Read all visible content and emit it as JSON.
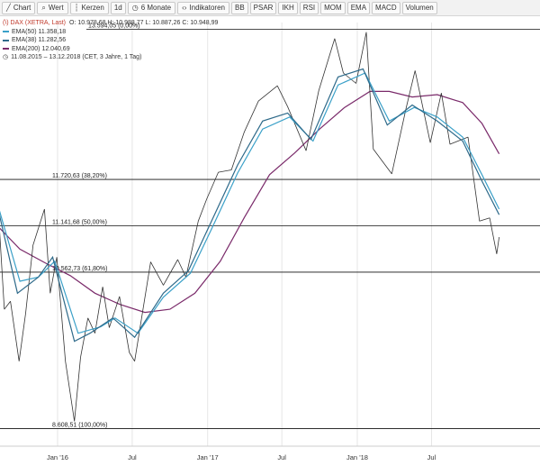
{
  "toolbar": {
    "items": [
      {
        "icon": "line-chart-icon",
        "label": "Chart"
      },
      {
        "icon": "search-icon",
        "label": "Wert"
      },
      {
        "icon": "candle-icon",
        "label": "Kerzen"
      },
      {
        "icon": "",
        "label": "1d"
      },
      {
        "icon": "clock-icon",
        "label": "6 Monate"
      },
      {
        "icon": "code-icon",
        "label": "Indikatoren"
      },
      {
        "icon": "",
        "label": "BB"
      },
      {
        "icon": "",
        "label": "PSAR"
      },
      {
        "icon": "",
        "label": "IKH"
      },
      {
        "icon": "",
        "label": "RSI"
      },
      {
        "icon": "",
        "label": "MOM"
      },
      {
        "icon": "",
        "label": "EMA"
      },
      {
        "icon": "",
        "label": "MACD"
      },
      {
        "icon": "",
        "label": "Volumen"
      }
    ]
  },
  "legend": {
    "instrument": "(\\) DAX (XETRA, Last)",
    "ohlc": "O: 10.978,68  H: 10.988,77  L: 10.887,26  C: 10.948,99",
    "ema50": "EMA(50)  11.358,18",
    "ema38": "EMA(38)  11.282,56",
    "ema200": "EMA(200)  12.040,69",
    "range": "11.08.2015 – 13.12.2018   (CET, 3 Jahre, 1 Tag)"
  },
  "colors": {
    "ema50": "#3aa0c8",
    "ema38": "#2e6a8a",
    "ema200": "#7a2a6a",
    "price": "#333333"
  },
  "chart_data": {
    "type": "line",
    "x_ticks": [
      "Jan '16",
      "Jul",
      "Jan '17",
      "Jul",
      "Jan '18",
      "Jul"
    ],
    "fib_levels": [
      {
        "label": "13.594,05 (0,00%)",
        "value": 13594.05
      },
      {
        "label": "11.720,63 (38,20%)",
        "value": 11720.63
      },
      {
        "label": "11.141,68 (50,00%)",
        "value": 11141.68
      },
      {
        "label": "10.562,73 (61,80%)",
        "value": 10562.73
      },
      {
        "label": "8.608,51 (100,00%)",
        "value": 8608.51
      }
    ],
    "ylim": [
      8480,
      13680
    ],
    "price": [
      [
        "2015-08-11",
        11200
      ],
      [
        "2015-08-24",
        10100
      ],
      [
        "2015-09-08",
        10200
      ],
      [
        "2015-09-29",
        9450
      ],
      [
        "2015-10-15",
        10050
      ],
      [
        "2015-11-02",
        10900
      ],
      [
        "2015-11-30",
        11350
      ],
      [
        "2015-12-14",
        10300
      ],
      [
        "2015-12-30",
        10750
      ],
      [
        "2016-01-20",
        9450
      ],
      [
        "2016-02-11",
        8700
      ],
      [
        "2016-02-26",
        9500
      ],
      [
        "2016-03-15",
        9990
      ],
      [
        "2016-04-01",
        9800
      ],
      [
        "2016-04-20",
        10380
      ],
      [
        "2016-05-06",
        9870
      ],
      [
        "2016-05-31",
        10260
      ],
      [
        "2016-06-24",
        9560
      ],
      [
        "2016-07-07",
        9450
      ],
      [
        "2016-08-15",
        10690
      ],
      [
        "2016-09-15",
        10400
      ],
      [
        "2016-10-20",
        10720
      ],
      [
        "2016-11-09",
        10500
      ],
      [
        "2016-12-09",
        11200
      ],
      [
        "2016-12-30",
        11480
      ],
      [
        "2017-01-27",
        11810
      ],
      [
        "2017-02-28",
        11840
      ],
      [
        "2017-03-31",
        12310
      ],
      [
        "2017-05-05",
        12700
      ],
      [
        "2017-06-20",
        12890
      ],
      [
        "2017-07-15",
        12630
      ],
      [
        "2017-08-29",
        12080
      ],
      [
        "2017-09-29",
        12830
      ],
      [
        "2017-11-07",
        13480
      ],
      [
        "2017-11-28",
        13050
      ],
      [
        "2017-12-29",
        12920
      ],
      [
        "2018-01-23",
        13560
      ],
      [
        "2018-02-09",
        12100
      ],
      [
        "2018-03-26",
        11790
      ],
      [
        "2018-04-30",
        12610
      ],
      [
        "2018-05-22",
        13080
      ],
      [
        "2018-06-28",
        12180
      ],
      [
        "2018-07-25",
        12800
      ],
      [
        "2018-08-15",
        12160
      ],
      [
        "2018-09-28",
        12250
      ],
      [
        "2018-10-26",
        11200
      ],
      [
        "2018-11-20",
        11240
      ],
      [
        "2018-12-07",
        10790
      ],
      [
        "2018-12-13",
        11000
      ]
    ],
    "ema38": [
      [
        "2015-08-11",
        11300
      ],
      [
        "2015-09-25",
        10300
      ],
      [
        "2015-11-15",
        10500
      ],
      [
        "2015-12-20",
        10750
      ],
      [
        "2016-02-11",
        9700
      ],
      [
        "2016-03-20",
        9800
      ],
      [
        "2016-05-15",
        9990
      ],
      [
        "2016-07-07",
        9750
      ],
      [
        "2016-09-15",
        10300
      ],
      [
        "2016-11-15",
        10580
      ],
      [
        "2017-01-15",
        11250
      ],
      [
        "2017-03-15",
        11900
      ],
      [
        "2017-05-15",
        12450
      ],
      [
        "2017-07-15",
        12550
      ],
      [
        "2017-09-10",
        12220
      ],
      [
        "2017-11-15",
        13000
      ],
      [
        "2018-01-15",
        13100
      ],
      [
        "2018-03-15",
        12400
      ],
      [
        "2018-05-15",
        12650
      ],
      [
        "2018-07-15",
        12450
      ],
      [
        "2018-09-15",
        12200
      ],
      [
        "2018-11-01",
        11700
      ],
      [
        "2018-12-13",
        11280
      ]
    ],
    "ema50": [
      [
        "2015-08-11",
        11350
      ],
      [
        "2015-10-01",
        10450
      ],
      [
        "2015-11-15",
        10500
      ],
      [
        "2015-12-25",
        10700
      ],
      [
        "2016-02-20",
        9800
      ],
      [
        "2016-04-15",
        9880
      ],
      [
        "2016-05-20",
        9990
      ],
      [
        "2016-07-15",
        9800
      ],
      [
        "2016-09-15",
        10250
      ],
      [
        "2016-11-20",
        10550
      ],
      [
        "2017-01-15",
        11150
      ],
      [
        "2017-03-15",
        11800
      ],
      [
        "2017-05-15",
        12350
      ],
      [
        "2017-07-20",
        12500
      ],
      [
        "2017-09-15",
        12200
      ],
      [
        "2017-11-15",
        12900
      ],
      [
        "2018-01-20",
        13050
      ],
      [
        "2018-03-20",
        12450
      ],
      [
        "2018-05-20",
        12620
      ],
      [
        "2018-07-15",
        12500
      ],
      [
        "2018-09-15",
        12250
      ],
      [
        "2018-11-01",
        11780
      ],
      [
        "2018-12-13",
        11350
      ]
    ],
    "ema200": [
      [
        "2015-08-11",
        11120
      ],
      [
        "2015-10-01",
        10850
      ],
      [
        "2015-12-01",
        10680
      ],
      [
        "2016-02-01",
        10520
      ],
      [
        "2016-04-01",
        10300
      ],
      [
        "2016-06-01",
        10160
      ],
      [
        "2016-08-01",
        10060
      ],
      [
        "2016-10-01",
        10100
      ],
      [
        "2016-12-01",
        10300
      ],
      [
        "2017-02-01",
        10700
      ],
      [
        "2017-04-01",
        11250
      ],
      [
        "2017-06-01",
        11780
      ],
      [
        "2017-08-01",
        12050
      ],
      [
        "2017-10-01",
        12350
      ],
      [
        "2017-12-01",
        12620
      ],
      [
        "2018-02-01",
        12820
      ],
      [
        "2018-03-20",
        12820
      ],
      [
        "2018-05-15",
        12750
      ],
      [
        "2018-07-15",
        12780
      ],
      [
        "2018-09-15",
        12680
      ],
      [
        "2018-11-01",
        12420
      ],
      [
        "2018-12-13",
        12040
      ]
    ]
  }
}
